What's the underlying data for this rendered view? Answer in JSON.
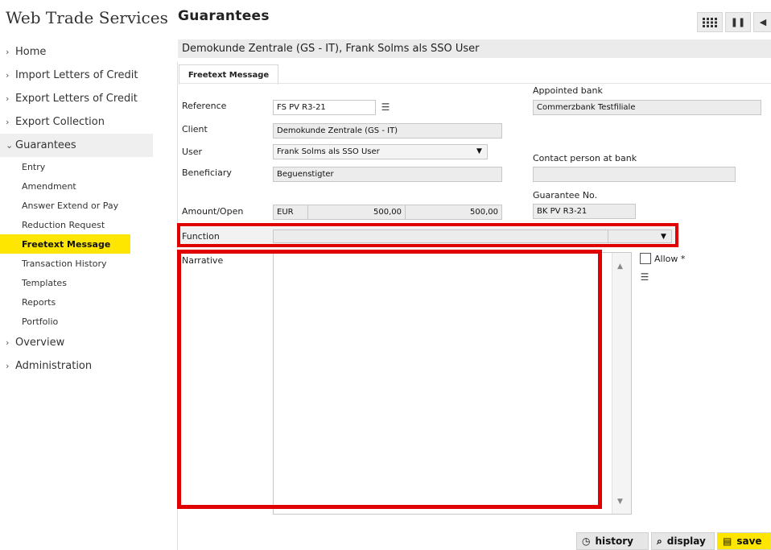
{
  "app": {
    "title": "Web Trade Services"
  },
  "sidebar": {
    "items": [
      {
        "label": "Home"
      },
      {
        "label": "Import Letters of Credit"
      },
      {
        "label": "Export Letters of Credit"
      },
      {
        "label": "Export Collection"
      },
      {
        "label": "Guarantees",
        "expanded": true
      },
      {
        "label": "Overview"
      },
      {
        "label": "Administration"
      }
    ],
    "guarantee_subitems": [
      {
        "label": "Entry"
      },
      {
        "label": "Amendment"
      },
      {
        "label": "Answer Extend or Pay"
      },
      {
        "label": "Reduction Request"
      },
      {
        "label": "Freetext Message",
        "active": true
      },
      {
        "label": "Transaction History"
      },
      {
        "label": "Templates"
      },
      {
        "label": "Reports"
      },
      {
        "label": "Portfolio"
      }
    ]
  },
  "header": {
    "title": "Guarantees",
    "context": "Demokunde Zentrale (GS - IT), Frank Solms als SSO User"
  },
  "tabs": [
    {
      "label": "Freetext Message"
    }
  ],
  "form": {
    "reference": {
      "label": "Reference",
      "value": "FS PV R3-21"
    },
    "client": {
      "label": "Client",
      "value": "Demokunde Zentrale (GS - IT)"
    },
    "user": {
      "label": "User",
      "value": "Frank Solms als SSO User"
    },
    "beneficiary": {
      "label": "Beneficiary",
      "value": "Beguenstigter"
    },
    "amount_open": {
      "label": "Amount/Open",
      "currency": "EUR",
      "amount": "500,00",
      "open": "500,00"
    },
    "appointed_bank": {
      "label": "Appointed bank",
      "value": "Commerzbank Testfiliale"
    },
    "contact_person": {
      "label": "Contact person at bank",
      "value": ""
    },
    "guarantee_no": {
      "label": "Guarantee No.",
      "value": "BK PV R3-21"
    },
    "function": {
      "label": "Function",
      "value": ""
    },
    "narrative": {
      "label": "Narrative",
      "value": ""
    },
    "allow": {
      "label": "Allow *",
      "checked": false
    }
  },
  "buttons": {
    "history": "history",
    "display": "display",
    "save": "save"
  },
  "colors": {
    "accent": "#ffe600",
    "highlight": "#e00000"
  }
}
